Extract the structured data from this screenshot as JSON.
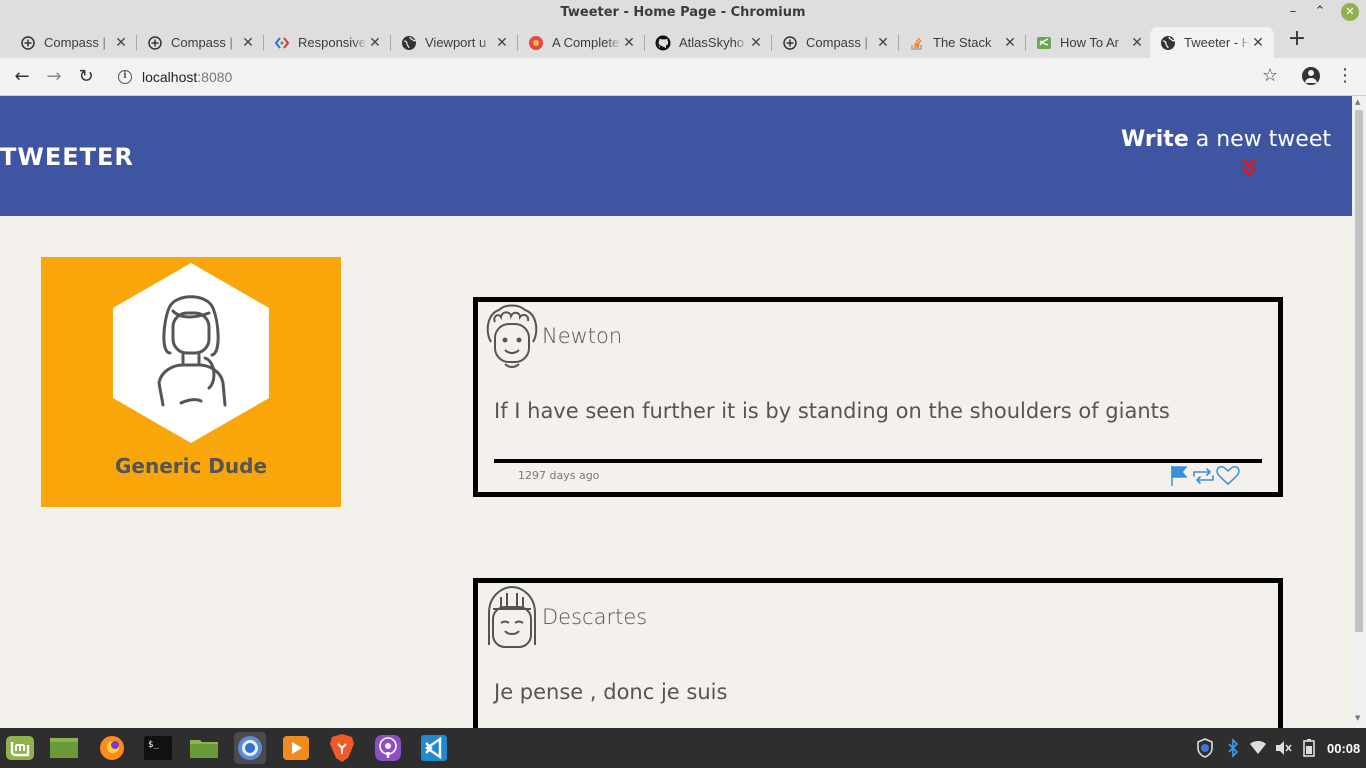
{
  "window": {
    "title": "Tweeter - Home Page - Chromium",
    "minimize_glyph": "–",
    "maximize_glyph": "⌃",
    "close_glyph": "✕"
  },
  "tabs": [
    {
      "label": "Compass | ",
      "icon": "compass-globe-icon"
    },
    {
      "label": "Compass | ",
      "icon": "compass-globe-icon"
    },
    {
      "label": "Responsive",
      "icon": "devtools-icon"
    },
    {
      "label": "Viewport u",
      "icon": "globe-icon"
    },
    {
      "label": "A Complete",
      "icon": "css-tricks-icon"
    },
    {
      "label": "AtlasSkyho",
      "icon": "github-icon"
    },
    {
      "label": "Compass | ",
      "icon": "compass-globe-icon"
    },
    {
      "label": "The Stack ",
      "icon": "stackoverflow-icon"
    },
    {
      "label": "How To Ar",
      "icon": "sass-icon"
    },
    {
      "label": "Tweeter - H",
      "icon": "globe-icon",
      "active": true
    }
  ],
  "toolbar": {
    "url_host": "localhost",
    "url_port": ":8080",
    "back_glyph": "←",
    "forward_glyph": "→",
    "reload_glyph": "↻",
    "info_glyph": "i",
    "star_glyph": "☆",
    "menu_glyph": "⋮",
    "new_tab_glyph": "+"
  },
  "header": {
    "brand": "TWEETER",
    "compose_bold": "Write",
    "compose_rest": " a new tweet"
  },
  "profile": {
    "name": "Generic Dude",
    "background_color": "#f9a60b"
  },
  "tweets": [
    {
      "author": "Newton",
      "text": "If I have seen further it is by standing on the shoulders of giants",
      "time": "1297 days ago"
    },
    {
      "author": "Descartes",
      "text": "Je pense , donc je suis",
      "time": ""
    }
  ],
  "taskbar": {
    "time": "00:08",
    "apps": [
      "mint-menu-icon",
      "desktop-icon",
      "firefox-icon",
      "terminal-icon",
      "files-icon",
      "chromium-icon",
      "media-player-icon",
      "brave-icon",
      "podcasts-icon",
      "vscode-icon"
    ]
  },
  "colors": {
    "header": "#4055a2",
    "page_bg": "#f4f1ec",
    "chevron": "#e01818",
    "action_icons": "#3a8fd6"
  }
}
